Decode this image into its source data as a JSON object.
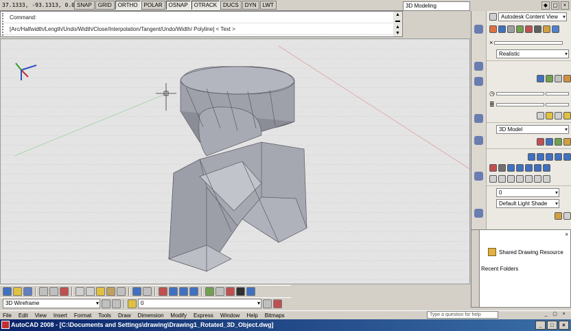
{
  "status": {
    "coords": "37.1333, -93.1313, 0.0000",
    "toggles": [
      "SNAP",
      "GRID",
      "ORTHO",
      "POLAR",
      "OSNAP",
      "OTRACK",
      "DUCS",
      "DYN",
      "LWT"
    ],
    "toggles_on": [
      2,
      4,
      5
    ],
    "workspace": "3D Modeling"
  },
  "cmdline": {
    "line1": "Command:",
    "line2": "[Arc/Halfwidth/Length/Undo/Width/Close/Interpolation/Tangent/Undo/Width/ Polyline] <  Text >"
  },
  "dashboard": {
    "top_label": "Autodesk Content View",
    "style_label": "Realistic",
    "combo2": "3D Model",
    "light_label": "Default Light Shade",
    "combo_layer": "0"
  },
  "palette": {
    "item": "Shared Drawing Resource",
    "section": "Recent Folders"
  },
  "toolbar2": {
    "visualstyle": "3D Wireframe",
    "layer": "0"
  },
  "menubar": [
    "File",
    "Edit",
    "View",
    "Insert",
    "Format",
    "Tools",
    "Draw",
    "Dimension",
    "Modify",
    "Express",
    "Window",
    "Help",
    "Bitmaps"
  ],
  "helpbox": "Type a question for help",
  "title": "AutoCAD 2008 - [C:\\Documents and Settings\\drawing\\Drawing1_Rotated_3D_Object.dwg]"
}
